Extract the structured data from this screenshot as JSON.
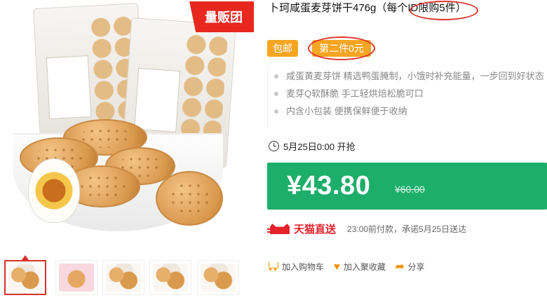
{
  "product": {
    "title": "卜珂咸蛋麦芽饼干476g（每个ID限购5件）",
    "tags": {
      "free_shipping": "包邮",
      "second_free": "第二件0元"
    },
    "features": [
      "咸蛋黄麦芽饼 精选鸭蛋腌制，小饿时补充能量，一步回到好状态",
      "麦芽Q软酥脆 手工轻烘焙松脆可口",
      "内含小包装 便携保鲜便于收纳"
    ],
    "sale_start": "5月25日0:00 开抢",
    "price": {
      "current": "¥43.80",
      "original": "¥60.00"
    },
    "delivery": {
      "brand": "天猫直送",
      "note": "23:00前付款，承诺5月25日送达"
    },
    "actions": {
      "add_cart": "加入购物车",
      "add_favorite": "加入聚收藏",
      "share": "分享"
    }
  },
  "gallery": {
    "badge": "量贩团",
    "thumbnails": [
      "thumb-1",
      "thumb-2",
      "thumb-3",
      "thumb-4",
      "thumb-5"
    ],
    "active_index": 0
  },
  "colors": {
    "price_bar": "#1cae6a",
    "tag": "#f6a623",
    "tmall_red": "#e5222c",
    "badge_red": "#e8281f",
    "action_orange": "#f39200"
  },
  "icons": [
    "clock-icon",
    "tmall-cat-icon",
    "cart-icon",
    "heart-icon",
    "share-icon"
  ]
}
